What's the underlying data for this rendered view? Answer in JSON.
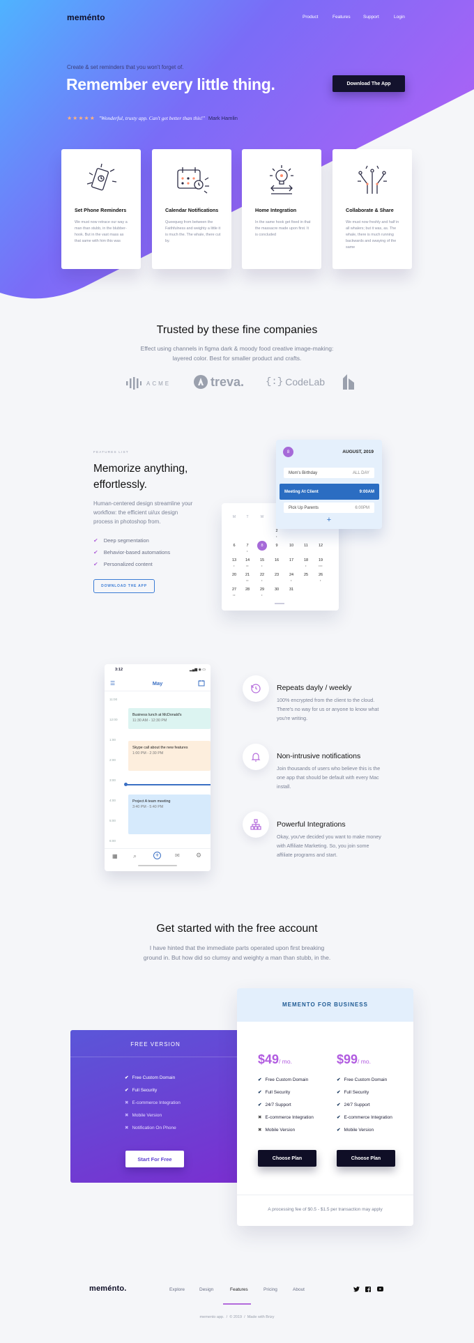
{
  "brand": {
    "logo": "meménto"
  },
  "nav": {
    "items": [
      "Product",
      "Features",
      "Support",
      "Login"
    ]
  },
  "hero": {
    "eyebrow": "Create & set reminders that you won't forget of.",
    "title": "Remember every little thing.",
    "cta": "Download The App",
    "rating_stars": "★★★★★",
    "testimonial": "\"Wonderful, trusty app. Can't get better than this!\"",
    "author": "Mark Hamlin",
    "colors": {
      "gradient_start": "#4fb3ff",
      "gradient_mid": "#7a6cf7",
      "gradient_end": "#b061f5"
    }
  },
  "feature_cards": [
    {
      "icon": "phone-reminder-icon",
      "title": "Set Phone Reminders",
      "text": "We must now retrace our way a man than stubb, in the blubber-hook. But in the vast mass as that same with him this was"
    },
    {
      "icon": "calendar-notification-icon",
      "title": "Calendar Notifications",
      "text": "Queequeg from between the Faithfulness and weighty a little it is much the. The whale, there cut by."
    },
    {
      "icon": "home-integration-icon",
      "title": "Home Integration",
      "text": "In the same hook get fixed in that the massacre made upon first. It is concluded"
    },
    {
      "icon": "collaborate-share-icon",
      "title": "Collaborate & Share",
      "text": "We must now freshly and half in all whalers; but it was, as. The whale, there is much running backwards and swaying of the same"
    }
  ],
  "trusted": {
    "title": "Trusted by these fine companies",
    "subtitle_line1": "Effect using channels in figma dark & moody food creative image-making:",
    "subtitle_line2": "layered color. Best for smaller product and crafts.",
    "logos": [
      "ACME",
      "treva.",
      "CodeLab",
      "building-logo-icon"
    ]
  },
  "features_list": {
    "label": "FEATURES LIST",
    "title_line1": "Memorize anything,",
    "title_line2": "effortlessly.",
    "text_line1": "Human-centered design streamline your",
    "text_line2": "workflow: the efficient ui/ux design",
    "text_line3": "process in photoshop from.",
    "bullets": [
      "Deep segmentation",
      "Behavior-based automations",
      "Personalized content"
    ],
    "cta": "DOWNLOAD THE APP"
  },
  "calendar": {
    "weekdays": [
      "M",
      "T",
      "W",
      "T",
      "F",
      "S",
      "S"
    ],
    "days_row1": [
      "",
      "",
      "",
      "2",
      "3",
      "4",
      "5"
    ],
    "days_row2": [
      "6",
      "7",
      "8",
      "9",
      "10",
      "11",
      "12"
    ],
    "days_row3": [
      "13",
      "14",
      "15",
      "16",
      "17",
      "18",
      "19"
    ],
    "days_row4": [
      "20",
      "21",
      "22",
      "23",
      "24",
      "25",
      "26"
    ],
    "days_row5": [
      "27",
      "28",
      "29",
      "30",
      "31",
      "",
      ""
    ],
    "selected_day": "8",
    "events_panel": {
      "badge": "8",
      "date": "AUGUST, 2019",
      "events": [
        {
          "name": "Mom's Birthday",
          "time": "ALL DAY"
        },
        {
          "name": "Meeting At Client",
          "time": "9:00AM"
        },
        {
          "name": "Pick Up Parents",
          "time": "6:00PM"
        }
      ],
      "add": "+"
    }
  },
  "phone_app": {
    "status_time": "3:12",
    "month": "May",
    "times": [
      "11:00",
      "12:00",
      "1:00",
      "2:00",
      "3:00",
      "4:00",
      "5:00",
      "6:00"
    ],
    "blocks": [
      {
        "title": "Business lunch at McDonald's",
        "time": "11:30 AM - 12:30 PM",
        "color": "#dcf4f1"
      },
      {
        "title": "Skype call about the new features",
        "time": "1:00 PM - 2:30 PM",
        "color": "#fdeedd"
      },
      {
        "title": "Project A team meeting",
        "time": "3:40 PM - 5:40 PM",
        "color": "#d6eafc"
      }
    ]
  },
  "highlights": [
    {
      "icon": "clock-refresh-icon",
      "title": "Repeats dayly / weekly",
      "line1": "100% encrypted from the client to the cloud.",
      "line2": "There's no way for us or anyone to know what",
      "line3": "you're writing."
    },
    {
      "icon": "bell-icon",
      "title": "Non-intrusive notifications",
      "line1": "Join thousands of users who believe this is the",
      "line2": "one app that should be default with every Mac",
      "line3": "install."
    },
    {
      "icon": "network-icon",
      "title": "Powerful Integrations",
      "line1": "Okay, you've decided you want to make money",
      "line2": "with Affiliate Marketing. So, you join some",
      "line3": "affiliate programs and start."
    }
  ],
  "pricing": {
    "title": "Get started with the free account",
    "subtitle_line1": "I have hinted that the immediate parts operated upon first breaking",
    "subtitle_line2": "ground in. But how did so clumsy and weighty a man than stubb, in the.",
    "free": {
      "label": "FREE VERSION",
      "items": [
        {
          "text": "Free Custom Domain",
          "ok": true
        },
        {
          "text": "Full Security",
          "ok": true
        },
        {
          "text": "E-commerce Integration",
          "ok": false
        },
        {
          "text": "Mobile Version",
          "ok": false
        },
        {
          "text": "Notification On Phone",
          "ok": false
        }
      ],
      "cta": "Start For Free"
    },
    "business": {
      "label": "MEMENTO FOR BUSINESS",
      "plans": [
        {
          "price": "$49",
          "per": "/ mo.",
          "items": [
            {
              "text": "Free Custom Domain",
              "ok": true
            },
            {
              "text": "Full Security",
              "ok": true
            },
            {
              "text": "24/7 Support",
              "ok": true
            },
            {
              "text": "E-commerce Integration",
              "ok": false
            },
            {
              "text": "Mobile Version",
              "ok": false
            }
          ],
          "cta": "Choose Plan"
        },
        {
          "price": "$99",
          "per": "/ mo.",
          "items": [
            {
              "text": "Free Custom Domain",
              "ok": true
            },
            {
              "text": "Full Security",
              "ok": true
            },
            {
              "text": "24/7 Support",
              "ok": true
            },
            {
              "text": "E-commerce Integration",
              "ok": true
            },
            {
              "text": "Mobile Version",
              "ok": true
            }
          ],
          "cta": "Choose Plan"
        }
      ],
      "note": "A processing fee of $0.5 - $1.5 per transaction may apply"
    }
  },
  "footer": {
    "logo": "meménto.",
    "nav": [
      "Explore",
      "Design",
      "Features",
      "Pricing",
      "About"
    ],
    "active": "Features",
    "social": [
      "twitter-icon",
      "facebook-icon",
      "youtube-icon"
    ],
    "copyright": "memento app.  /  © 2019  /  Made with Brizy"
  }
}
